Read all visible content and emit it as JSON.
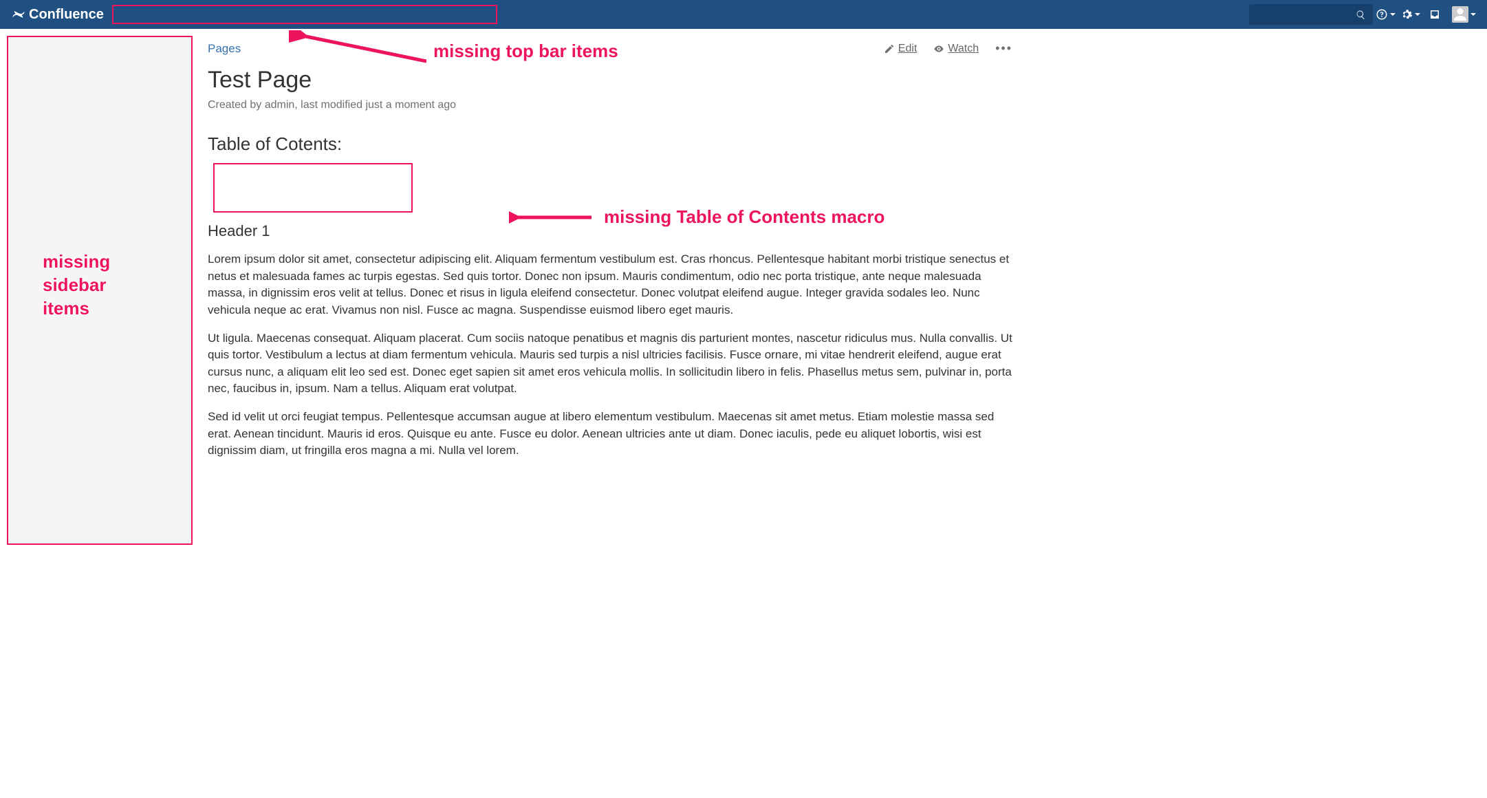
{
  "brand": "Confluence",
  "breadcrumb": {
    "pages": "Pages"
  },
  "actions": {
    "edit": "Edit",
    "watch": "Watch"
  },
  "page": {
    "title": "Test Page",
    "byline": "Created by admin, last modified just a moment ago",
    "toc_heading": "Table of Cotents:",
    "h3": "Header 1",
    "p1": "Lorem ipsum dolor sit amet, consectetur adipiscing elit. Aliquam fermentum vestibulum est. Cras rhoncus. Pellentesque habitant morbi tristique senectus et netus et malesuada fames ac turpis egestas. Sed quis tortor. Donec non ipsum. Mauris condimentum, odio nec porta tristique, ante neque malesuada massa, in dignissim eros velit at tellus. Donec et risus in ligula eleifend consectetur. Donec volutpat eleifend augue. Integer gravida sodales leo. Nunc vehicula neque ac erat. Vivamus non nisl. Fusce ac magna. Suspendisse euismod libero eget mauris.",
    "p2": "Ut ligula. Maecenas consequat. Aliquam placerat. Cum sociis natoque penatibus et magnis dis parturient montes, nascetur ridiculus mus. Nulla convallis. Ut quis tortor. Vestibulum a lectus at diam fermentum vehicula. Mauris sed turpis a nisl ultricies facilisis. Fusce ornare, mi vitae hendrerit eleifend, augue erat cursus nunc, a aliquam elit leo sed est. Donec eget sapien sit amet eros vehicula mollis. In sollicitudin libero in felis. Phasellus metus sem, pulvinar in, porta nec, faucibus in, ipsum. Nam a tellus. Aliquam erat volutpat.",
    "p3": "Sed id velit ut orci feugiat tempus. Pellentesque accumsan augue at libero elementum vestibulum. Maecenas sit amet metus. Etiam molestie massa sed erat. Aenean tincidunt. Mauris id eros. Quisque eu ante. Fusce eu dolor. Aenean ultricies ante ut diam. Donec iaculis, pede eu aliquet lobortis, wisi est dignissim diam, ut fringilla eros magna a mi. Nulla vel lorem."
  },
  "annotations": {
    "topbar": "missing top bar items",
    "sidebar": "missing\nsidebar\nitems",
    "toc": "missing Table of Contents macro"
  }
}
